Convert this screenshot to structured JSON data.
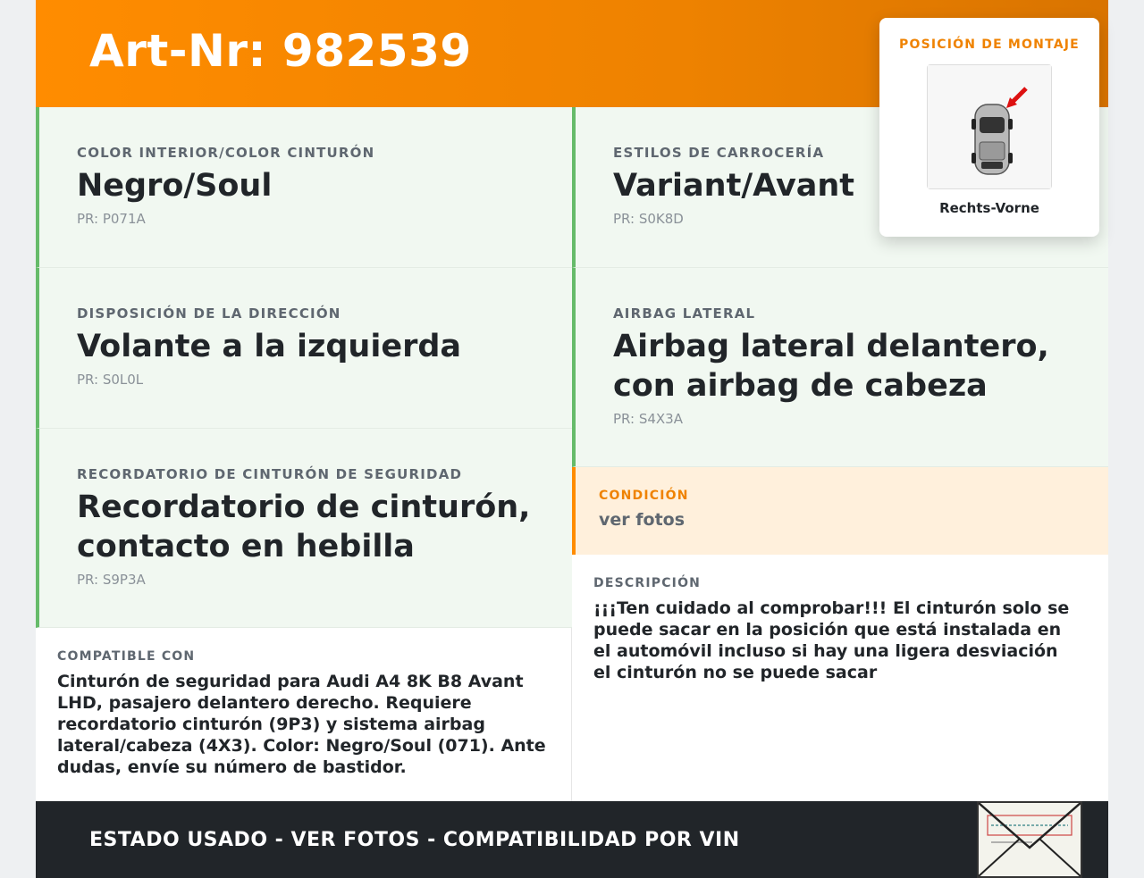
{
  "header": {
    "title": "Art-Nr: 982539"
  },
  "attributes": [
    {
      "label": "COLOR INTERIOR/COLOR CINTURÓN",
      "value": "Negro/Soul",
      "pr": "PR: P071A"
    },
    {
      "label": "ESTILOS DE CARROCERÍA",
      "value": "Variant/Avant",
      "pr": "PR: S0K8D"
    },
    {
      "label": "DISPOSICIÓN DE LA DIRECCIÓN",
      "value": "Volante a la izquierda",
      "pr": "PR: S0L0L"
    },
    {
      "label": "AIRBAG LATERAL",
      "value": "Airbag lateral delantero, con airbag de cabeza",
      "pr": "PR: S4X3A"
    },
    {
      "label": "RECORDATORIO DE CINTURÓN DE SEGURIDAD",
      "value": "Recordatorio de cinturón, contacto en hebilla",
      "pr": "PR: S9P3A"
    }
  ],
  "condition": {
    "label": "CONDICIÓN",
    "value": "ver fotos"
  },
  "compatible": {
    "label": "COMPATIBLE CON",
    "text": "Cinturón de seguridad para Audi A4 8K B8 Avant LHD, pasajero delantero derecho. Requiere recordatorio cinturón (9P3) y sistema airbag lateral/cabeza (4X3). Color: Negro/Soul (071). Ante dudas, envíe su número de bastidor."
  },
  "description": {
    "label": "DESCRIPCIÓN",
    "text": "¡¡¡Ten cuidado al comprobar!!! El cinturón solo se puede sacar en la posición que está instalada en el automóvil incluso si hay una ligera desviación el cinturón no se puede sacar"
  },
  "mounting": {
    "label": "POSICIÓN DE MONTAJE",
    "caption": "Rechts-Vorne",
    "icon": "car-top-view-with-arrow"
  },
  "footer": {
    "text": "ESTADO USADO - VER FOTOS - COMPATIBILIDAD POR VIN",
    "stamp_icon": "envelope-stamp-icon"
  },
  "colors": {
    "accent": "#ff8c00",
    "green": "#66bb6a",
    "footer": "#212529",
    "cell_bg": "#f1f8f1"
  }
}
